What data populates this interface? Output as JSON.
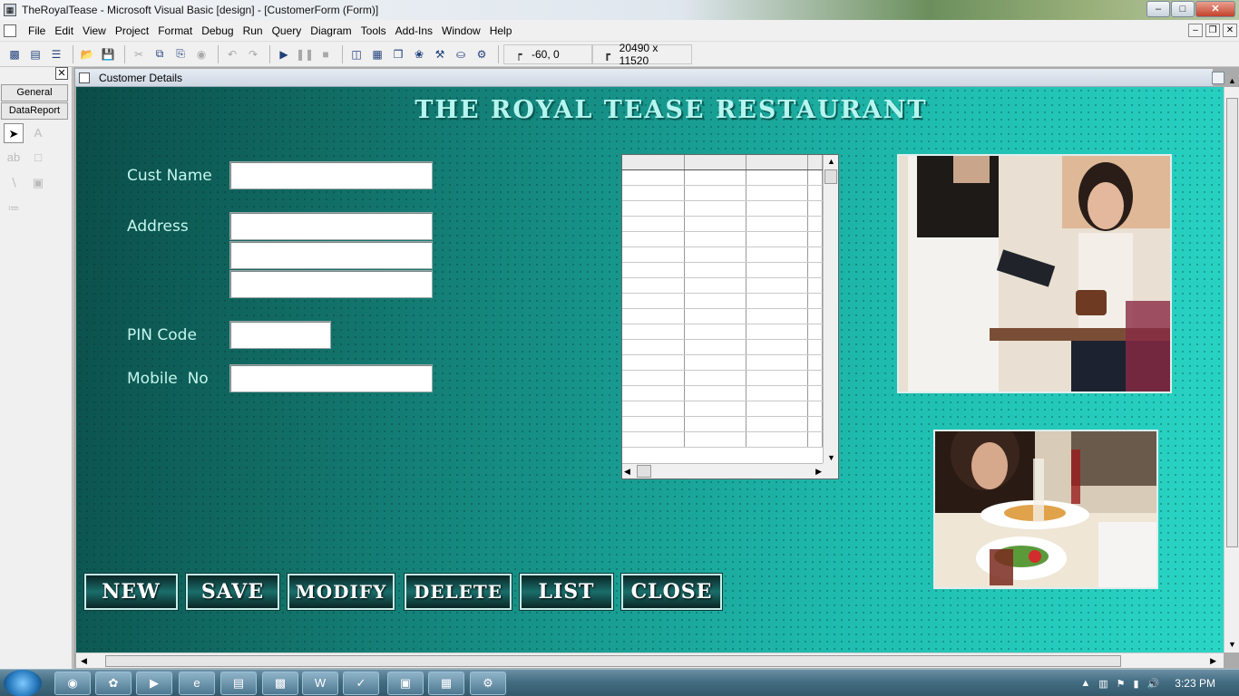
{
  "window": {
    "title": "TheRoyalTease - Microsoft Visual Basic [design] - [CustomerForm (Form)]",
    "minimize": "–",
    "maximize": "□",
    "close": "✕"
  },
  "menu": [
    "File",
    "Edit",
    "View",
    "Project",
    "Format",
    "Debug",
    "Run",
    "Query",
    "Diagram",
    "Tools",
    "Add-Ins",
    "Window",
    "Help"
  ],
  "toolbar": {
    "position_readout": "-60, 0",
    "size_readout": "20490 x 11520"
  },
  "toolbox": {
    "tabs": [
      "General",
      "DataReport"
    ],
    "close": "✕"
  },
  "form": {
    "caption": "Customer Details",
    "heading": "THE ROYAL TEASE RESTAURANT",
    "labels": {
      "cust_name": "Cust Name",
      "address": "Address",
      "pin_code": "PIN Code",
      "mobile_no": "Mobile  No"
    },
    "buttons": {
      "new": "NEW",
      "save": "SAVE",
      "modify": "MODIFY",
      "delete": "DELETE",
      "list": "LIST",
      "close": "CLOSE"
    }
  },
  "taskbar": {
    "clock": "3:23 PM"
  },
  "colors": {
    "form_bg": "#1cb3a6",
    "heading": "#b4f6ef",
    "label": "#c4f6ee",
    "button_bg": "#0a2625"
  }
}
